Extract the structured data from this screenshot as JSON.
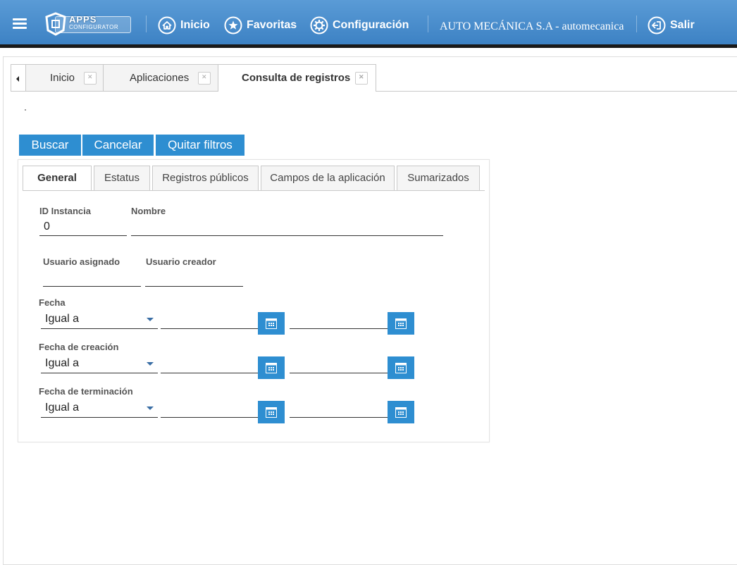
{
  "header": {
    "logo_line1": "APPS",
    "logo_line2": "CONFIGURATOR",
    "nav": [
      {
        "label": "Inicio",
        "icon": "home-icon"
      },
      {
        "label": "Favoritas",
        "icon": "star-icon"
      },
      {
        "label": "Configuración",
        "icon": "gear-icon"
      }
    ],
    "company": "AUTO MECÁNICA S.A - automecanica",
    "logout_label": "Salir",
    "colors": {
      "bar": "#4a8fcf",
      "accent": "#2e8ed1"
    }
  },
  "tabs": [
    {
      "label": "Inicio",
      "active": false
    },
    {
      "label": "Aplicaciones",
      "active": false
    },
    {
      "label": "Consulta de registros",
      "active": true
    }
  ],
  "page": {
    "marker": "."
  },
  "actions": {
    "search": "Buscar",
    "cancel": "Cancelar",
    "clear_filters": "Quitar filtros"
  },
  "panel_tabs": [
    {
      "label": "General",
      "active": true
    },
    {
      "label": "Estatus",
      "active": false
    },
    {
      "label": "Registros públicos",
      "active": false
    },
    {
      "label": "Campos de la aplicación",
      "active": false
    },
    {
      "label": "Sumarizados",
      "active": false
    }
  ],
  "form": {
    "id_instancia": {
      "label": "ID Instancia",
      "value": "0"
    },
    "nombre": {
      "label": "Nombre",
      "value": ""
    },
    "usuario_asignado": {
      "label": "Usuario asignado",
      "value": ""
    },
    "usuario_creador": {
      "label": "Usuario creador",
      "value": ""
    },
    "fecha": {
      "label": "Fecha",
      "operator": "Igual a"
    },
    "fecha_creacion": {
      "label": "Fecha de creación",
      "operator": "Igual a"
    },
    "fecha_terminacion": {
      "label": "Fecha de terminación",
      "operator": "Igual a"
    }
  }
}
